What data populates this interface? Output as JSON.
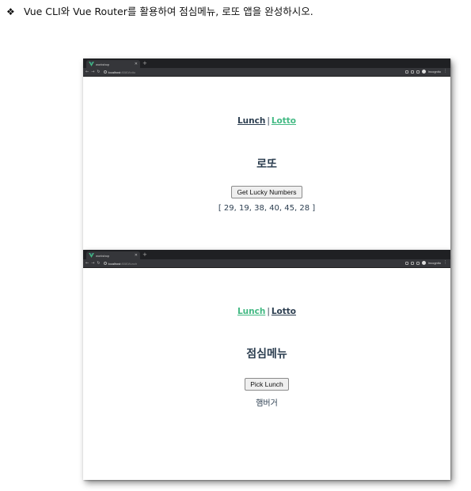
{
  "instruction": {
    "bullet": "❖",
    "text": "Vue CLI와 Vue Router를 활용하여 점심메뉴, 로또 앱을 완성하시오."
  },
  "browser": {
    "tab_title": "workshop",
    "new_tab": "+",
    "profile": "Incognito"
  },
  "lotto_window": {
    "url_host": "localhost",
    "url_path": ":8080/lotto",
    "nav": {
      "lunch": "Lunch",
      "separator": "|",
      "lotto": "Lotto"
    },
    "heading": "로또",
    "button": "Get Lucky Numbers",
    "result": "[ 29, 19, 38, 40, 45, 28 ]"
  },
  "lunch_window": {
    "url_host": "localhost",
    "url_path": ":8080/lunch",
    "nav": {
      "lunch": "Lunch",
      "separator": "|",
      "lotto": "Lotto"
    },
    "heading": "점심메뉴",
    "button": "Pick Lunch",
    "result": "햄버거"
  },
  "colors": {
    "active_link": "#42b983",
    "text": "#2c3e50",
    "chrome_dark": "#1f2023",
    "chrome_bar": "#35363a"
  }
}
